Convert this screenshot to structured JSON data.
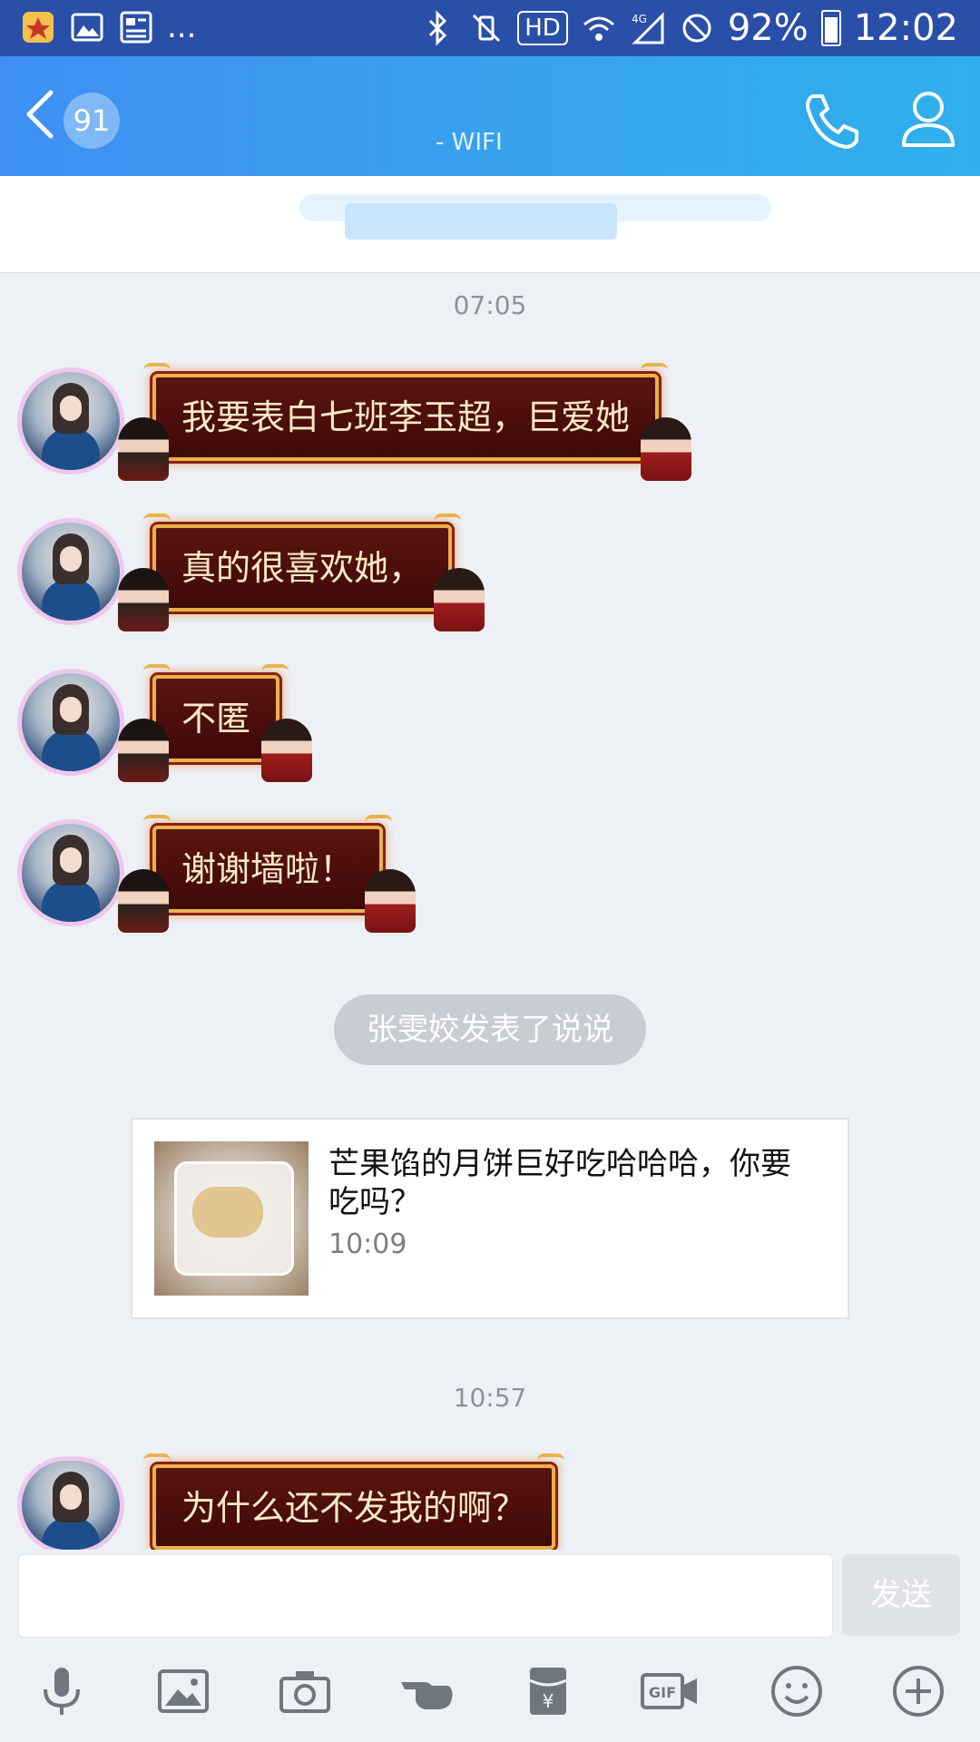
{
  "status_bar": {
    "battery_percent": "92%",
    "time": "12:02",
    "network_badge": "HD",
    "more": "..."
  },
  "header": {
    "unread_count": "91",
    "subtitle": "- WIFI",
    "icons": [
      "back-icon",
      "phone-icon",
      "profile-icon"
    ]
  },
  "messages": [
    {
      "type": "timestamp",
      "text": "07:05"
    },
    {
      "type": "bubble",
      "text": "我要表白七班李玉超，巨爱她"
    },
    {
      "type": "bubble",
      "text": "真的很喜欢她，"
    },
    {
      "type": "bubble",
      "text": "不匿"
    },
    {
      "type": "bubble",
      "text": "谢谢墙啦！"
    },
    {
      "type": "system",
      "text": "张雯姣发表了说说"
    },
    {
      "type": "card",
      "text": "芒果馅的月饼巨好吃哈哈哈，你要吃吗？",
      "time": "10:09"
    },
    {
      "type": "timestamp",
      "text": "10:57"
    },
    {
      "type": "bubble",
      "text": "为什么还不发我的啊？"
    }
  ],
  "input": {
    "send_label": "发送",
    "tools": [
      "microphone-icon",
      "image-icon",
      "camera-icon",
      "hand-icon",
      "red-packet-icon",
      "gif-icon",
      "emoji-icon",
      "plus-icon"
    ]
  },
  "colors": {
    "header_start": "#3f8ff2",
    "header_end": "#2fb0ec",
    "status_bar": "#2a4fa8",
    "bubble_bg": "#4a0e0b",
    "bubble_border": "#e9b24a",
    "bubble_text": "#fbe9c6",
    "background": "#edf1f6"
  }
}
